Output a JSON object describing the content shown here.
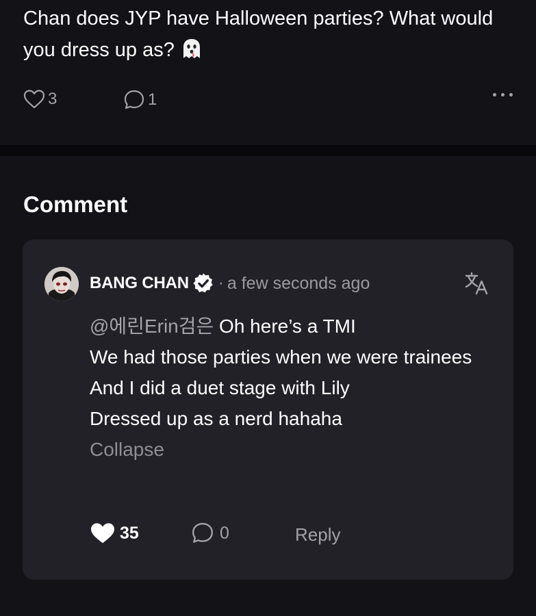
{
  "post": {
    "text": "Chan does JYP have Halloween parties? What would you dress up as?",
    "emoji_icon": "ghost-emoji",
    "likes": "3",
    "comments": "1",
    "more_icon": "more-horizontal-icon"
  },
  "section": {
    "title": "Comment"
  },
  "comment": {
    "author": "BANG CHAN",
    "verified_icon": "verified-badge-icon",
    "separator": "·",
    "timestamp": "a few seconds ago",
    "translate_icon": "translate-icon",
    "mention": "@에린Erin검은",
    "lines": [
      " Oh here’s a TMI",
      "We had those parties when we were trainees",
      "And I did a duet stage with Lily",
      "Dressed up as a nerd hahaha"
    ],
    "collapse_label": "Collapse",
    "likes": "35",
    "replies": "0",
    "reply_label": "Reply"
  },
  "colors": {
    "background": "#131217",
    "divider": "#09090b",
    "card": "#222127",
    "muted_text": "#a3a3a9",
    "text": "#ffffff"
  }
}
